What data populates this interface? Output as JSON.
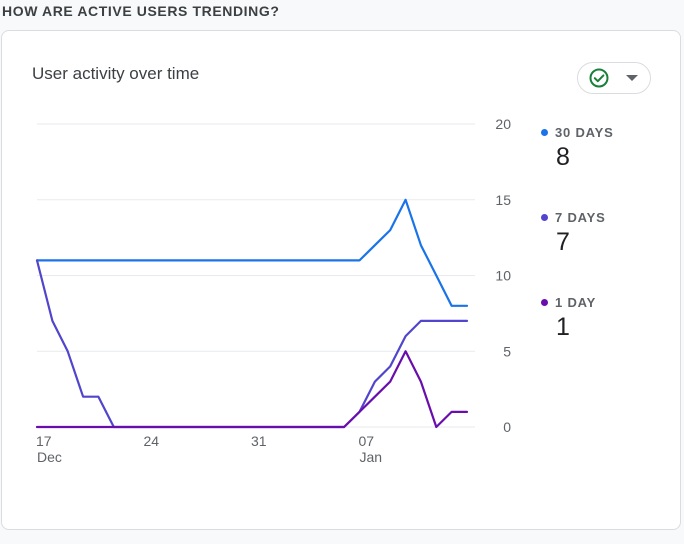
{
  "section_title": "HOW ARE ACTIVE USERS TRENDING?",
  "card": {
    "title": "User activity over time",
    "status_icon": "check-circle-icon",
    "dropdown_icon": "caret-down-icon"
  },
  "colors": {
    "series_30": "#1a73e8",
    "series_7": "#5145cd",
    "series_1": "#6a0dad",
    "status": "#188038"
  },
  "legend": [
    {
      "label": "30 DAYS",
      "value": "8"
    },
    {
      "label": "7 DAYS",
      "value": "7"
    },
    {
      "label": "1 DAY",
      "value": "1"
    }
  ],
  "chart_data": {
    "type": "line",
    "x_ticks": [
      {
        "label": "17",
        "sublabel": "Dec"
      },
      {
        "label": "24",
        "sublabel": ""
      },
      {
        "label": "31",
        "sublabel": ""
      },
      {
        "label": "07",
        "sublabel": "Jan"
      }
    ],
    "x": [
      "Dec 17",
      "Dec 18",
      "Dec 19",
      "Dec 20",
      "Dec 21",
      "Dec 22",
      "Dec 23",
      "Dec 24",
      "Dec 25",
      "Dec 26",
      "Dec 27",
      "Dec 28",
      "Dec 29",
      "Dec 30",
      "Dec 31",
      "Jan 01",
      "Jan 02",
      "Jan 03",
      "Jan 04",
      "Jan 05",
      "Jan 06",
      "Jan 07",
      "Jan 08",
      "Jan 09",
      "Jan 10",
      "Jan 11",
      "Jan 12",
      "Jan 13",
      "Jan 14"
    ],
    "series": [
      {
        "name": "30 DAYS",
        "values": [
          11,
          11,
          11,
          11,
          11,
          11,
          11,
          11,
          11,
          11,
          11,
          11,
          11,
          11,
          11,
          11,
          11,
          11,
          11,
          11,
          11,
          11,
          12,
          13,
          15,
          12,
          10,
          8,
          8
        ]
      },
      {
        "name": "7 DAYS",
        "values": [
          11,
          7,
          5,
          2,
          2,
          0,
          0,
          0,
          0,
          0,
          0,
          0,
          0,
          0,
          0,
          0,
          0,
          0,
          0,
          0,
          0,
          1,
          3,
          4,
          6,
          7,
          7,
          7,
          7
        ]
      },
      {
        "name": "1 DAY",
        "values": [
          0,
          0,
          0,
          0,
          0,
          0,
          0,
          0,
          0,
          0,
          0,
          0,
          0,
          0,
          0,
          0,
          0,
          0,
          0,
          0,
          0,
          1,
          2,
          3,
          5,
          3,
          0,
          1,
          1
        ]
      }
    ],
    "y_ticks": [
      0,
      5,
      10,
      15,
      20
    ],
    "ylim": [
      0,
      20
    ],
    "grid": true,
    "y_axis_position": "right",
    "legend_position": "right"
  }
}
